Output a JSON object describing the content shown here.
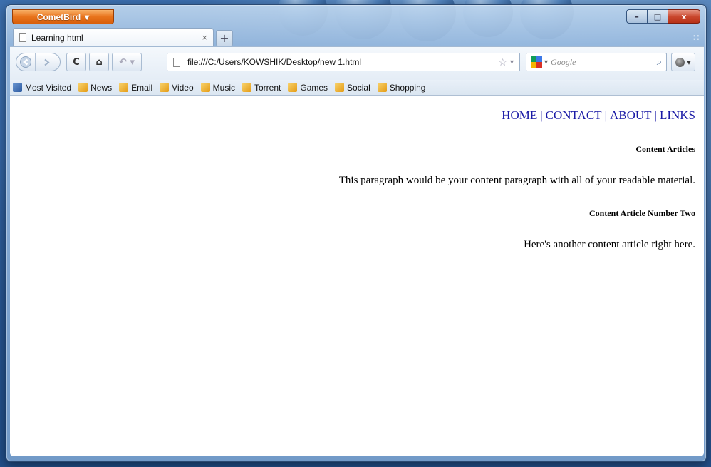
{
  "window": {
    "app_button_label": "CometBird",
    "minimize_glyph": "–",
    "maximize_glyph": "□",
    "close_glyph": "x"
  },
  "tab": {
    "title": "Learning html",
    "close_glyph": "×",
    "new_tab_glyph": "+",
    "tab_list_glyph": "::"
  },
  "navigation": {
    "back_icon": "back-arrow-icon",
    "forward_icon": "forward-arrow-icon",
    "reload_glyph": "C",
    "home_glyph": "⌂",
    "url": "file:///C:/Users/KOWSHIK/Desktop/new 1.html",
    "search_placeholder": "Google"
  },
  "bookmarks": [
    {
      "label": "Most Visited",
      "icon": "most-visited-icon"
    },
    {
      "label": "News",
      "icon": "rss-folder-icon"
    },
    {
      "label": "Email",
      "icon": "rss-folder-icon"
    },
    {
      "label": "Video",
      "icon": "rss-folder-icon"
    },
    {
      "label": "Music",
      "icon": "rss-folder-icon"
    },
    {
      "label": "Torrent",
      "icon": "rss-folder-icon"
    },
    {
      "label": "Games",
      "icon": "rss-folder-icon"
    },
    {
      "label": "Social",
      "icon": "rss-folder-icon"
    },
    {
      "label": "Shopping",
      "icon": "rss-folder-icon"
    }
  ],
  "page": {
    "nav_links": [
      "HOME",
      "CONTACT",
      "ABOUT",
      "LINKS"
    ],
    "separator": "|",
    "heading_1": "Content Articles",
    "paragraph_1": "This paragraph would be your content paragraph with all of your readable material.",
    "heading_2": "Content Article Number Two",
    "paragraph_2": "Here's another content article right here."
  },
  "colors": {
    "link": "#1a1aa6",
    "app_button": "#e8731c",
    "close_button": "#c8452b"
  }
}
